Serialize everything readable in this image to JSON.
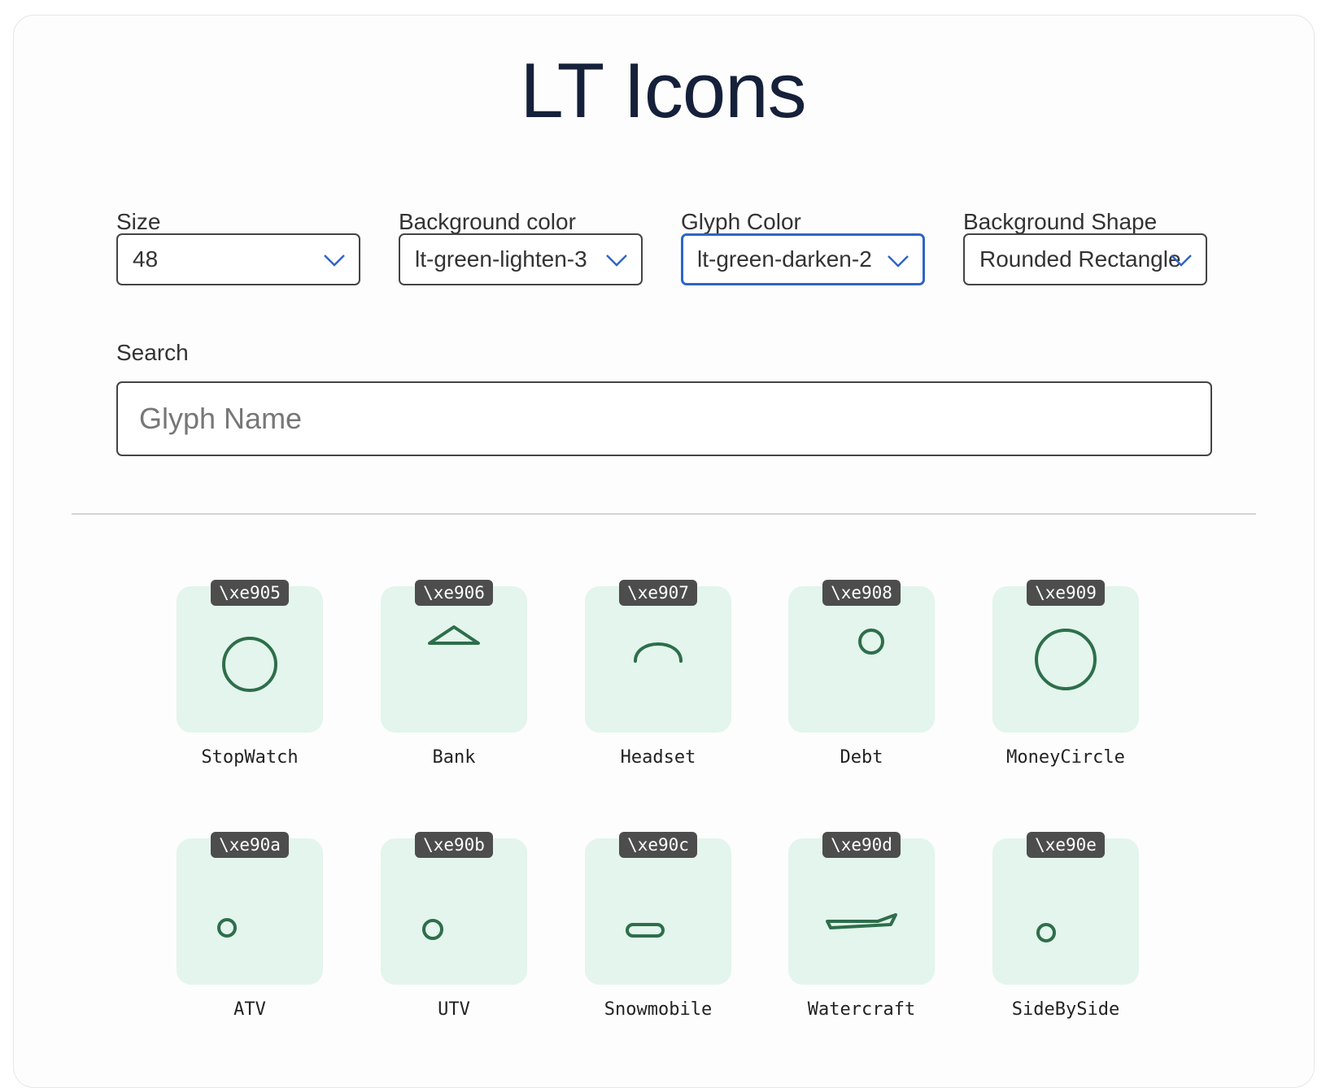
{
  "page": {
    "title": "LT Icons"
  },
  "controls": {
    "size": {
      "label": "Size",
      "value": "48"
    },
    "background_color": {
      "label": "Background color",
      "value": "lt-green-lighten-3"
    },
    "glyph_color": {
      "label": "Glyph Color",
      "value": "lt-green-darken-2"
    },
    "background_shape": {
      "label": "Background Shape",
      "value": "Rounded Rectangle"
    },
    "search": {
      "label": "Search",
      "placeholder": "Glyph Name",
      "value": ""
    }
  },
  "colors": {
    "tile_background": "#e3f5ec",
    "glyph": "#2e6e4b",
    "code_badge": "#4d4d4d",
    "focus_border": "#2f64c6"
  },
  "icons": [
    {
      "code": "\\xe905",
      "name": "StopWatch",
      "glyph": "stopwatch-icon"
    },
    {
      "code": "\\xe906",
      "name": "Bank",
      "glyph": "bank-icon"
    },
    {
      "code": "\\xe907",
      "name": "Headset",
      "glyph": "headset-icon"
    },
    {
      "code": "\\xe908",
      "name": "Debt",
      "glyph": "debt-icon"
    },
    {
      "code": "\\xe909",
      "name": "MoneyCircle",
      "glyph": "money-circle-icon"
    },
    {
      "code": "\\xe90a",
      "name": "ATV",
      "glyph": "atv-icon"
    },
    {
      "code": "\\xe90b",
      "name": "UTV",
      "glyph": "utv-icon"
    },
    {
      "code": "\\xe90c",
      "name": "Snowmobile",
      "glyph": "snowmobile-icon"
    },
    {
      "code": "\\xe90d",
      "name": "Watercraft",
      "glyph": "watercraft-icon"
    },
    {
      "code": "\\xe90e",
      "name": "SideBySide",
      "glyph": "side-by-side-icon"
    }
  ]
}
